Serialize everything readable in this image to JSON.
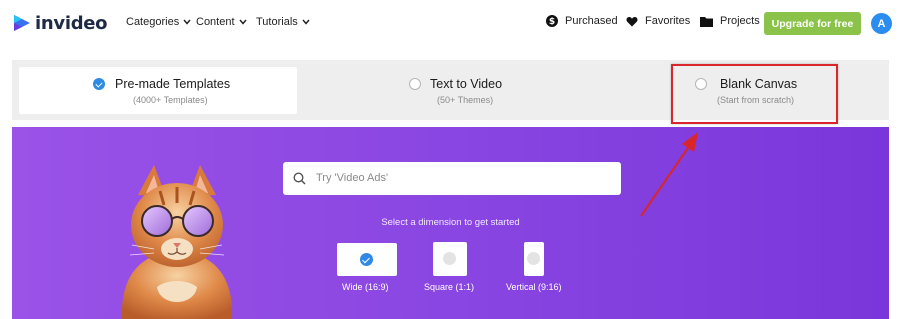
{
  "brand": {
    "name": "invideo"
  },
  "nav": {
    "categories": "Categories",
    "content": "Content",
    "tutorials": "Tutorials"
  },
  "user_nav": {
    "purchased": "Purchased",
    "favorites": "Favorites",
    "projects": "Projects",
    "upgrade": "Upgrade for free",
    "avatar_initial": "A"
  },
  "tabs": [
    {
      "title": "Pre-made Templates",
      "subtitle": "(4000+ Templates)",
      "selected": true
    },
    {
      "title": "Text to Video",
      "subtitle": "(50+ Themes)",
      "selected": false
    },
    {
      "title": "Blank Canvas",
      "subtitle": "(Start from scratch)",
      "selected": false
    }
  ],
  "hero": {
    "search_placeholder": "Try 'Video Ads'",
    "dimension_prompt": "Select a dimension to get started",
    "dimensions": [
      {
        "label": "Wide (16:9)",
        "selected": true
      },
      {
        "label": "Square (1:1)",
        "selected": false
      },
      {
        "label": "Vertical (9:16)",
        "selected": false
      }
    ]
  },
  "colors": {
    "accent": "#2e8ae6",
    "upgrade": "#8bc34a",
    "hero_from": "#9a52e7",
    "hero_to": "#7a36da",
    "annotation": "#d9262b"
  },
  "icons": {
    "purchased": "dollar-circle-icon",
    "favorites": "heart-icon",
    "projects": "folder-icon",
    "search": "search-icon"
  }
}
